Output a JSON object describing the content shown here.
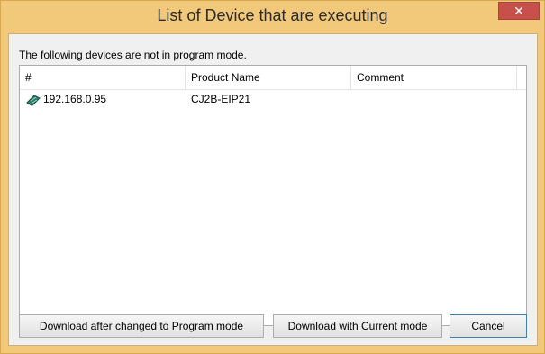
{
  "window": {
    "title": "List of Device that are executing",
    "close_label": "✕"
  },
  "message": "The following devices are not in program mode.",
  "list": {
    "columns": [
      "#",
      "Product Name",
      "Comment"
    ],
    "rows": [
      {
        "address": "192.168.0.95",
        "product": "CJ2B-EIP21",
        "comment": ""
      }
    ]
  },
  "buttons": {
    "program_mode": "Download after changed to Program mode",
    "current_mode": "Download with Current mode",
    "cancel": "Cancel"
  },
  "colors": {
    "frame": "#f2c97a",
    "close": "#c7504a"
  },
  "icons": {
    "device": "plc-device-icon"
  }
}
